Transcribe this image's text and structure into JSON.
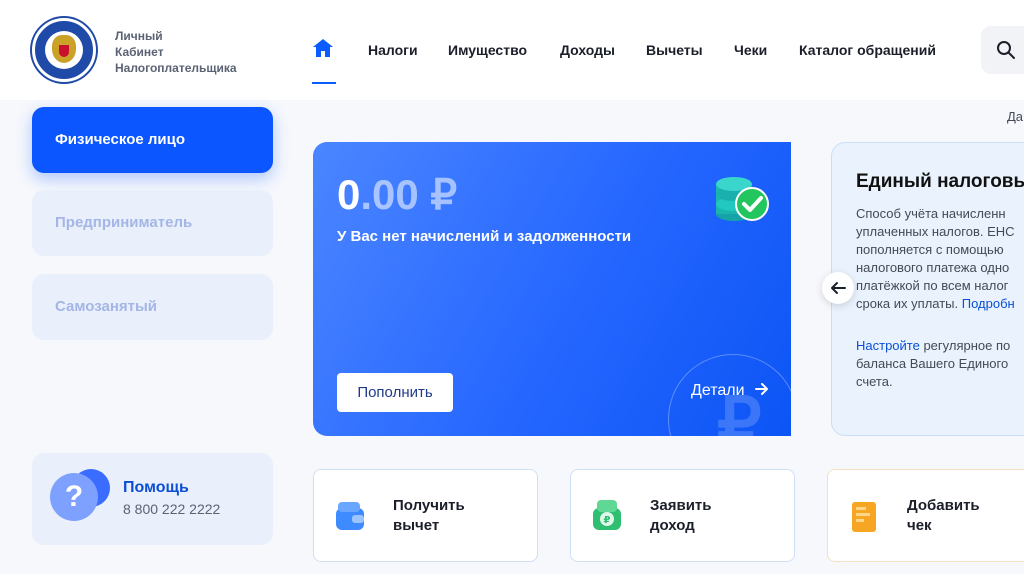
{
  "brand": {
    "line1": "Личный",
    "line2": "Кабинет",
    "line3": "Налогоплательщика"
  },
  "nav": {
    "items": [
      "Налоги",
      "Имущество",
      "Доходы",
      "Вычеты",
      "Чеки",
      "Каталог обращений"
    ]
  },
  "dateline": "Да",
  "sidebar": {
    "items": [
      "Физическое лицо",
      "Предприниматель",
      "Самозанятый"
    ],
    "active_index": 0
  },
  "help": {
    "icon_glyph": "?",
    "title": "Помощь",
    "phone": "8 800 222 2222"
  },
  "balance": {
    "amount_int": "0",
    "amount_dec": ".00 ₽",
    "status": "У Вас нет начислений и задолженности",
    "topup_label": "Пополнить",
    "details_label": "Детали"
  },
  "ens": {
    "title": "Единый налоговы",
    "text_lines": [
      "Способ учёта начисленн",
      "уплаченных налогов. ЕНС",
      "пополняется с помощью",
      "налогового платежа одно",
      "платёжкой по всем налог"
    ],
    "text_last_prefix": "срока их уплаты. ",
    "text_last_link": "Подробн",
    "setup_link": "Настройте",
    "setup_rest": " регулярное по",
    "setup_line2": "баланса Вашего Единого",
    "setup_line3": "счета."
  },
  "actions": [
    {
      "line1": "Получить",
      "line2": "вычет"
    },
    {
      "line1": "Заявить",
      "line2": "доход"
    },
    {
      "line1": "Добавить",
      "line2": "чек"
    }
  ],
  "colors": {
    "accent": "#0b56ff",
    "link": "#0a4fd6",
    "success": "#22c55e"
  }
}
